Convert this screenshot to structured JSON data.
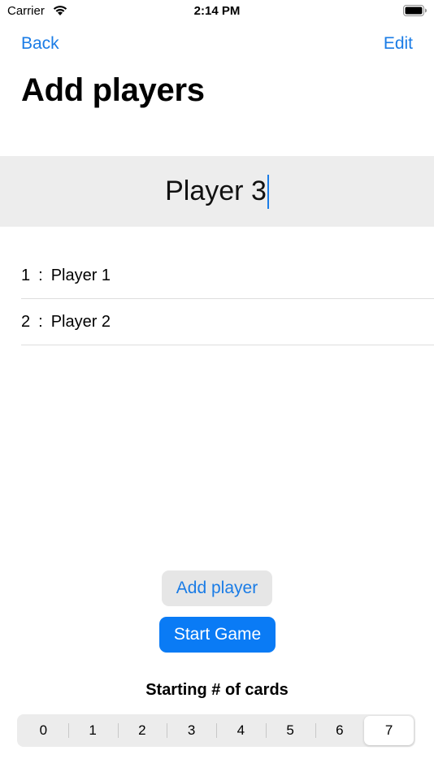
{
  "status_bar": {
    "carrier": "Carrier",
    "time": "2:14 PM"
  },
  "nav": {
    "back_label": "Back",
    "edit_label": "Edit",
    "title": "Add players"
  },
  "name_input": {
    "value": "Player 3"
  },
  "players": [
    {
      "number": "1",
      "separator": ":",
      "name": "Player 1"
    },
    {
      "number": "2",
      "separator": ":",
      "name": "Player 2"
    }
  ],
  "buttons": {
    "add_player": "Add player",
    "start_game": "Start Game"
  },
  "cards": {
    "label": "Starting # of cards",
    "options": [
      "0",
      "1",
      "2",
      "3",
      "4",
      "5",
      "6",
      "7"
    ],
    "selected": "7"
  },
  "colors": {
    "accent": "#1a7ce6",
    "primary_button": "#0a7bf5",
    "input_background": "#ededed"
  }
}
